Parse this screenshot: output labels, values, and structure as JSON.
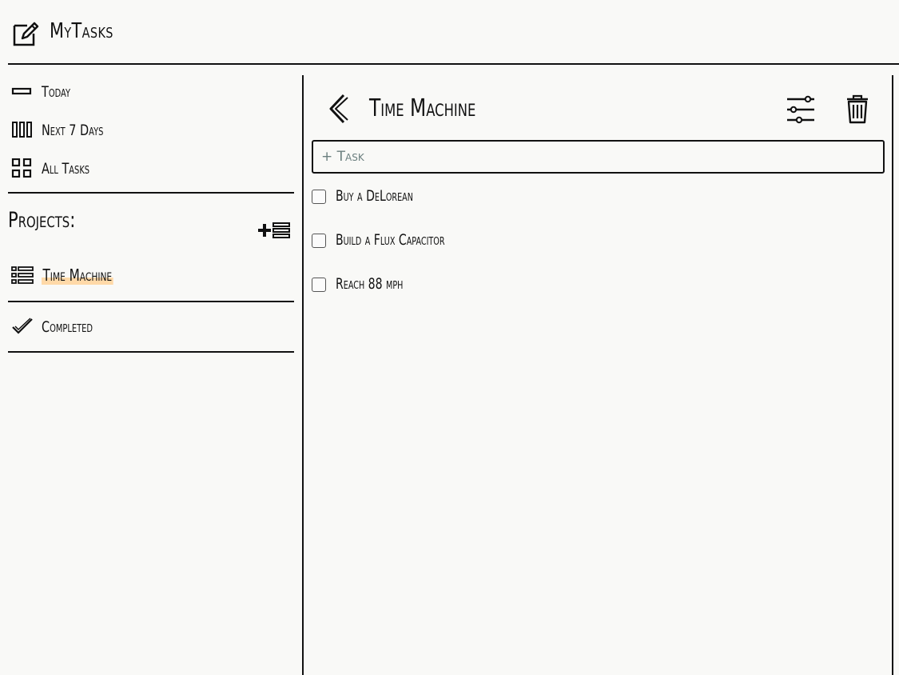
{
  "app": {
    "title": "MyTasks"
  },
  "sidebar": {
    "items": [
      {
        "label": "Today",
        "icon": "single-bar-icon"
      },
      {
        "label": "Next 7 Days",
        "icon": "columns-icon"
      },
      {
        "label": "All Tasks",
        "icon": "grid-icon"
      }
    ],
    "projects_heading": "Projects:",
    "add_project_icon": "add-list-icon",
    "projects": [
      {
        "label": "Time Machine",
        "icon": "list-icon",
        "highlight": "#ffd9a8"
      }
    ],
    "completed": {
      "label": "Completed",
      "icon": "checkmark-icon"
    }
  },
  "main": {
    "project_title": "Time Machine",
    "task_input": {
      "placeholder": "+ Task",
      "value": ""
    },
    "tasks": [
      {
        "label": "Buy a DeLorean",
        "checked": false
      },
      {
        "label": "Build a Flux Capacitor",
        "checked": false
      },
      {
        "label": "Reach 88 mph",
        "checked": false
      }
    ],
    "icons": {
      "back": "chevron-left-icon",
      "filter": "sliders-icon",
      "delete": "trash-icon"
    }
  },
  "colors": {
    "background": "#f9f9f7",
    "ink": "#111111",
    "highlight": "#ffd9a8",
    "placeholder": "#6b7f7f"
  }
}
